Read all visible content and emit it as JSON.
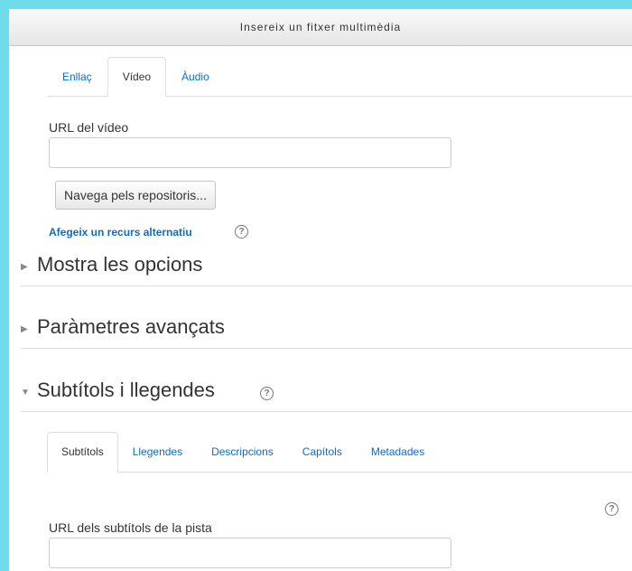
{
  "dialog": {
    "title": "Insereix un fitxer multimèdia"
  },
  "media_tabs": [
    {
      "label": "Enllaç",
      "active": false
    },
    {
      "label": "Vídeo",
      "active": true
    },
    {
      "label": "Àudio",
      "active": false
    }
  ],
  "video": {
    "url_label": "URL del vídeo",
    "url_value": "",
    "browse_button": "Navega pels repositoris...",
    "add_alternative_link": "Afegeix un recurs alternatiu"
  },
  "sections": {
    "display_options": "Mostra les opcions",
    "advanced_settings": "Paràmetres avançats",
    "subtitles": "Subtítols i llegendes"
  },
  "subtitle_tabs": [
    {
      "label": "Subtítols",
      "active": true
    },
    {
      "label": "Llegendes",
      "active": false
    },
    {
      "label": "Descripcions",
      "active": false
    },
    {
      "label": "Capítols",
      "active": false
    },
    {
      "label": "Metadades",
      "active": false
    }
  ],
  "subtitles_panel": {
    "url_label": "URL dels subtítols de la pista",
    "url_value": ""
  },
  "icons": {
    "help": "?",
    "collapsed": "▶",
    "expanded": "▼"
  },
  "colors": {
    "link": "#0f6cbf",
    "border_accent": "#6fdcec"
  }
}
